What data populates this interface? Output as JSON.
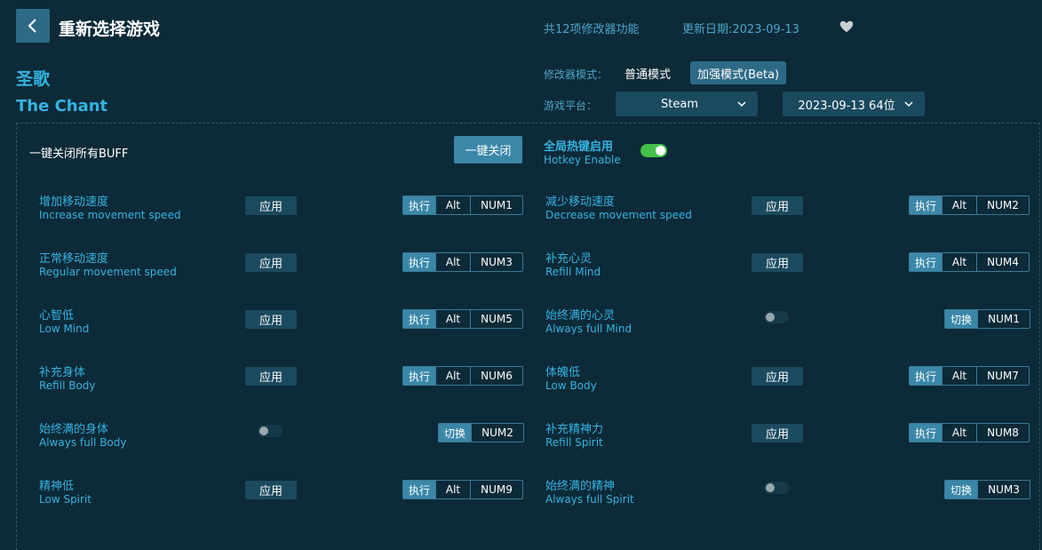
{
  "header": {
    "title": "重新选择游戏",
    "feature_count": "共12项修改器功能",
    "update_date": "更新日期:2023-09-13"
  },
  "game": {
    "name_cn": "圣歌",
    "name_en": "The Chant"
  },
  "mode": {
    "label": "修改器模式：",
    "normal": "普通模式",
    "beta": "加强模式(Beta)",
    "selected": "加强模式(Beta)"
  },
  "platform": {
    "label": "游戏平台：",
    "platform_value": "Steam",
    "version_value": "2023-09-13 64位"
  },
  "buff": {
    "label": "一键关闭所有BUFF",
    "close_all": "一键关闭"
  },
  "hotkey": {
    "label_cn": "全局热键启用",
    "label_en": "Hotkey Enable",
    "enabled": true
  },
  "labels": {
    "apply": "应用",
    "execute": "执行",
    "switch": "切换",
    "alt": "Alt"
  },
  "items": [
    {
      "cn": "增加移动速度",
      "en": "Increase movement speed",
      "kind": "apply",
      "key": "NUM1"
    },
    {
      "cn": "减少移动速度",
      "en": "Decrease movement speed",
      "kind": "apply",
      "key": "NUM2"
    },
    {
      "cn": "正常移动速度",
      "en": "Regular movement speed",
      "kind": "apply",
      "key": "NUM3"
    },
    {
      "cn": "补充心灵",
      "en": "Refill Mind",
      "kind": "apply",
      "key": "NUM4"
    },
    {
      "cn": "心智低",
      "en": "Low Mind",
      "kind": "apply",
      "key": "NUM5"
    },
    {
      "cn": "始终满的心灵",
      "en": "Always full Mind",
      "kind": "toggle",
      "key": "NUM1"
    },
    {
      "cn": "补充身体",
      "en": "Refill Body",
      "kind": "apply",
      "key": "NUM6"
    },
    {
      "cn": "体魄低",
      "en": "Low Body",
      "kind": "apply",
      "key": "NUM7"
    },
    {
      "cn": "始终满的身体",
      "en": "Always full Body",
      "kind": "toggle",
      "key": "NUM2"
    },
    {
      "cn": "补充精神力",
      "en": "Refill Spirit",
      "kind": "apply",
      "key": "NUM8"
    },
    {
      "cn": "精神低",
      "en": "Low Spirit",
      "kind": "apply",
      "key": "NUM9"
    },
    {
      "cn": "始终满的精神",
      "en": "Always full Spirit",
      "kind": "toggle",
      "key": "NUM3"
    }
  ],
  "icons": {
    "back": "chevron-left-icon",
    "favorite": "heart-icon",
    "dropdown": "chevron-down-icon"
  },
  "colors": {
    "background": "#0c2a38",
    "accent": "#35b3e0",
    "button": "#3a87a8",
    "toggle_on": "#45c04a"
  }
}
